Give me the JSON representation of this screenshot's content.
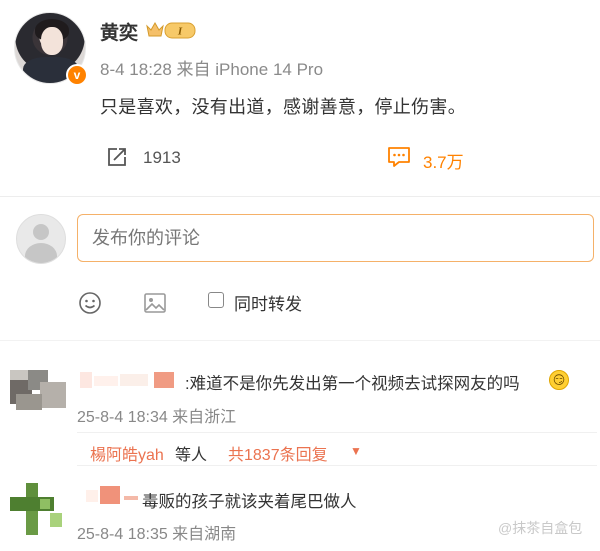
{
  "post": {
    "username": "黄奕",
    "badge_label": "I",
    "meta": "8-4 18:28 来自 iPhone 14 Pro",
    "content": "只是喜欢，没有出道，感谢善意，停止伤害。",
    "repost_count": "1913",
    "comment_count": "3.7万",
    "verified_mark": "v"
  },
  "composer": {
    "placeholder": "发布你的评论",
    "also_repost_label": "同时转发"
  },
  "comments": [
    {
      "name_prefix": ":",
      "text": "难道不是你先发出第一个视频去试探网友的吗",
      "emoji": "😏",
      "meta": "25-8-4 18:34 来自浙江",
      "replies": {
        "user": "楊阿皓yah",
        "etc": "等人",
        "total": "共1837条回复",
        "caret": "▼"
      }
    },
    {
      "text": "毒贩的孩子就该夹着尾巴做人",
      "meta": "25-8-4 18:35 来自湖南"
    }
  ],
  "watermark": "@抹茶自盒包",
  "colors": {
    "accent": "#ff8200",
    "link": "#eb7350",
    "input_border": "#f5b169",
    "meta_gray": "#8a8a8a"
  },
  "icons": [
    "repost-icon",
    "comment-icon",
    "emoji-icon",
    "image-icon",
    "crown-badge-icon"
  ]
}
